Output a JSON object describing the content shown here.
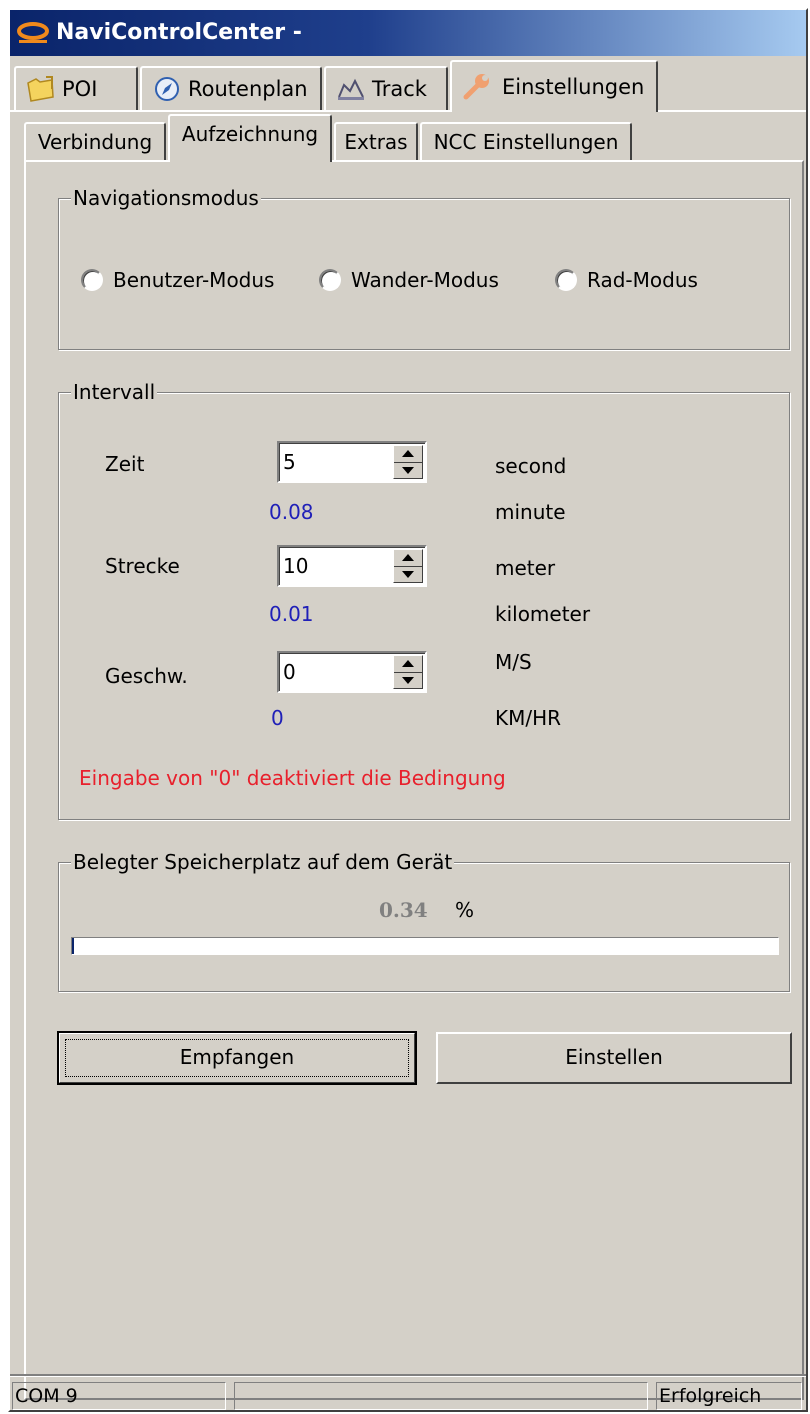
{
  "window": {
    "title": "NaviControlCenter -"
  },
  "main_tabs": [
    {
      "label": "POI",
      "icon": "folder-icon"
    },
    {
      "label": "Routenplan",
      "icon": "compass-icon"
    },
    {
      "label": "Track",
      "icon": "track-icon"
    },
    {
      "label": "Einstellungen",
      "icon": "wrench-icon",
      "selected": true
    }
  ],
  "sub_tabs": [
    {
      "label": "Verbindung"
    },
    {
      "label": "Aufzeichnung",
      "selected": true
    },
    {
      "label": "Extras"
    },
    {
      "label": "NCC Einstellungen"
    }
  ],
  "navigation_mode": {
    "legend": "Navigationsmodus",
    "options": [
      "Benutzer-Modus",
      "Wander-Modus",
      "Rad-Modus"
    ],
    "selected": null
  },
  "interval": {
    "legend": "Intervall",
    "time": {
      "label": "Zeit",
      "value": "5",
      "unit": "second",
      "converted": "0.08",
      "converted_unit": "minute"
    },
    "distance": {
      "label": "Strecke",
      "value": "10",
      "unit": "meter",
      "converted": "0.01",
      "converted_unit": "kilometer"
    },
    "speed": {
      "label": "Geschw.",
      "value": "0",
      "unit": "M/S",
      "converted": "0",
      "converted_unit": "KM/HR"
    },
    "warning": "Eingabe von \"0\" deaktiviert die Bedingung"
  },
  "storage": {
    "legend": "Belegter Speicherplatz auf dem Gerät",
    "value": "0.34",
    "unit": "%",
    "progress_percent": 0.34
  },
  "buttons": {
    "receive": "Empfangen",
    "set": "Einstellen"
  },
  "status_bar": {
    "port": "COM 9",
    "middle": "",
    "result": "Erfolgreich"
  },
  "colors": {
    "title_bar": "#0a246a",
    "converted_value": "#2020b8",
    "warning": "#e8202c",
    "window_bg": "#d4d0c8"
  }
}
